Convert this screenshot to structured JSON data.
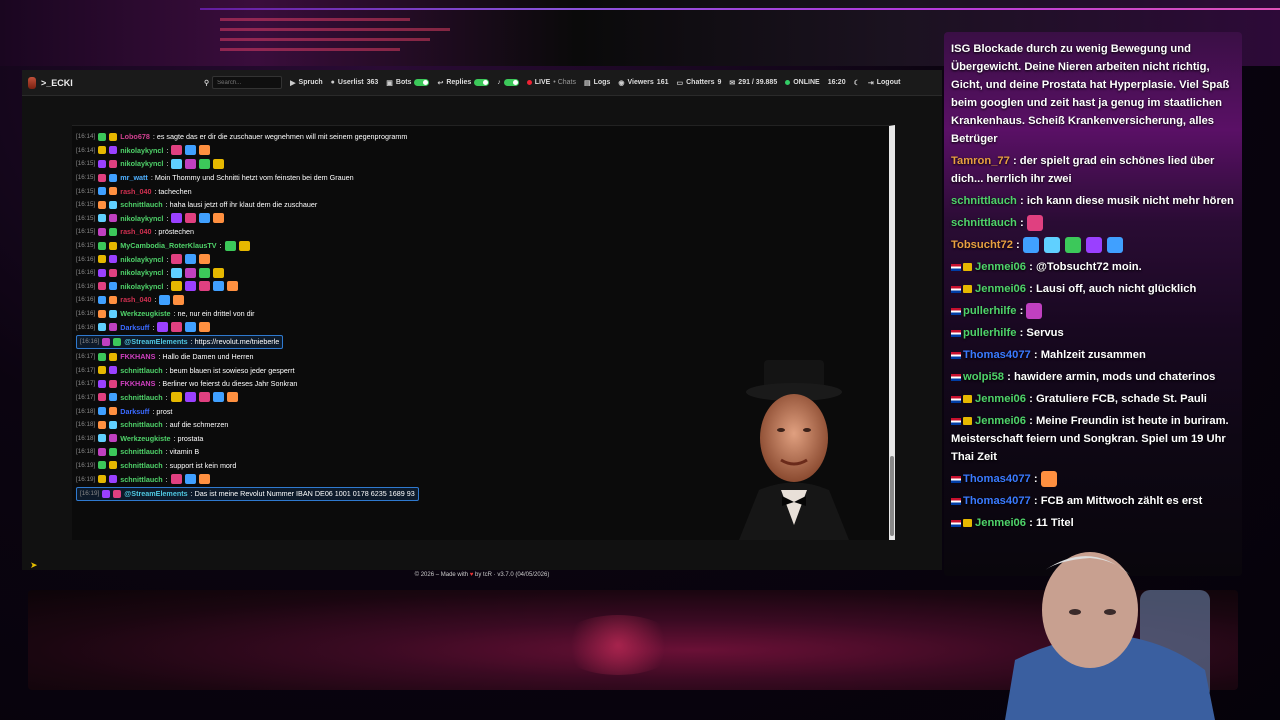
{
  "app": {
    "brand": ">_ECKI",
    "search_placeholder": "Search...",
    "nav": {
      "spruch": "Spruch",
      "userlist_label": "Userlist",
      "userlist_count": "363",
      "bots": "Bots",
      "replies": "Replies",
      "live": "LIVE",
      "chats": "• Chats",
      "logs": "Logs",
      "viewers_label": "Viewers",
      "viewers_count": "161",
      "chatters_label": "Chatters",
      "chatters_count": "9",
      "messages": "291 / 39.885",
      "online": "ONLINE",
      "time": "16:20",
      "logout": "Logout"
    },
    "footer": {
      "prefix": "© 2026 – Made with",
      "suffix": "by tcR · v3.7.0 (04/05/2026)"
    }
  },
  "chat_lines": [
    {
      "ts": "[16:14]",
      "nick": "Lobo678",
      "color": "#d04090",
      "text": ": es sagte das er dir die zuschauer wegnehmen will mit seinem gegenprogramm",
      "hl": false
    },
    {
      "ts": "[16:14]",
      "nick": "nikolaykyncl",
      "color": "#4fd36a",
      "text": ":",
      "hl": false
    },
    {
      "ts": "[16:15]",
      "nick": "nikolaykyncl",
      "color": "#4fd36a",
      "text": ":",
      "hl": false
    },
    {
      "ts": "[16:15]",
      "nick": "mr_watt",
      "color": "#4fb0ff",
      "text": ": Moin Thommy und Schnitti hetzt vom feinsten bei dem Grauen",
      "hl": false
    },
    {
      "ts": "[16:15]",
      "nick": "rash_040",
      "color": "#d03050",
      "text": ": tachechen",
      "hl": false
    },
    {
      "ts": "[16:15]",
      "nick": "schnittlauch",
      "color": "#4fd36a",
      "text": ": haha lausi jetzt off ihr klaut dem die zuschauer",
      "hl": false
    },
    {
      "ts": "[16:15]",
      "nick": "nikolaykyncl",
      "color": "#4fd36a",
      "text": ":",
      "hl": false
    },
    {
      "ts": "[16:15]",
      "nick": "rash_040",
      "color": "#d03050",
      "text": ": pröstechen",
      "hl": false
    },
    {
      "ts": "[16:15]",
      "nick": "MyCambodia_RoterKlausTV",
      "color": "#4fd36a",
      "text": ":",
      "hl": false
    },
    {
      "ts": "[16:16]",
      "nick": "nikolaykyncl",
      "color": "#4fd36a",
      "text": ":",
      "hl": false
    },
    {
      "ts": "[16:16]",
      "nick": "nikolaykyncl",
      "color": "#4fd36a",
      "text": ":",
      "hl": false
    },
    {
      "ts": "[16:16]",
      "nick": "nikolaykyncl",
      "color": "#4fd36a",
      "text": ":",
      "hl": false
    },
    {
      "ts": "[16:16]",
      "nick": "rash_040",
      "color": "#d03050",
      "text": ":",
      "hl": false
    },
    {
      "ts": "[16:16]",
      "nick": "Werkzeugkiste",
      "color": "#4fd36a",
      "text": ": ne, nur ein drittel von dir",
      "hl": false
    },
    {
      "ts": "[16:16]",
      "nick": "Darksuff",
      "color": "#3a6aff",
      "text": ":",
      "hl": false
    },
    {
      "ts": "[16:16]",
      "nick": "@StreamElements",
      "color": "#4fc6e0",
      "text": ": https://revolut.me/tnieberle",
      "hl": true
    },
    {
      "ts": "[16:17]",
      "nick": "FKKHANS",
      "color": "#d040c0",
      "text": ": Hallo die Damen und Herren",
      "hl": false
    },
    {
      "ts": "[16:17]",
      "nick": "schnittlauch",
      "color": "#4fd36a",
      "text": ": beum blauen ist sowieso jeder gesperrt",
      "hl": false
    },
    {
      "ts": "[16:17]",
      "nick": "FKKHANS",
      "color": "#d040c0",
      "text": ": Berliner wo feierst du dieses Jahr Sonkran",
      "hl": false
    },
    {
      "ts": "[16:17]",
      "nick": "schnittlauch",
      "color": "#4fd36a",
      "text": ":",
      "hl": false
    },
    {
      "ts": "[16:18]",
      "nick": "Darksuff",
      "color": "#3a6aff",
      "text": ": prost",
      "hl": false
    },
    {
      "ts": "[16:18]",
      "nick": "schnittlauch",
      "color": "#4fd36a",
      "text": ": auf die schmerzen",
      "hl": false
    },
    {
      "ts": "[16:18]",
      "nick": "Werkzeugkiste",
      "color": "#4fd36a",
      "text": ": prostata",
      "hl": false
    },
    {
      "ts": "[16:18]",
      "nick": "schnittlauch",
      "color": "#4fd36a",
      "text": ": vitamin B",
      "hl": false
    },
    {
      "ts": "[16:19]",
      "nick": "schnittlauch",
      "color": "#4fd36a",
      "text": ": support ist kein mord",
      "hl": false
    },
    {
      "ts": "[16:19]",
      "nick": "schnittlauch",
      "color": "#4fd36a",
      "text": ":",
      "hl": false
    },
    {
      "ts": "[16:19]",
      "nick": "@StreamElements",
      "color": "#4fc6e0",
      "text": ": Das ist meine Revolut Nummer IBAN DE06 1001 0178 6235 1689 93",
      "hl": true
    }
  ],
  "overlay_lines": [
    {
      "nick": "",
      "color": "#ffffff",
      "text": "ISG Blockade durch zu wenig Bewegung und Übergewicht. Deine Nieren arbeiten nicht richtig, Gicht, und deine Prostata hat Hyperplasie. Viel Spaß beim googlen und zeit hast ja genug im staatlichen Krankenhaus. Scheiß Krankenversicherung, alles Betrüger",
      "flag": false,
      "crown": false
    },
    {
      "nick": "Tamron_77",
      "color": "#e8a040",
      "text": " : der spielt grad ein schönes lied über dich... herrlich ihr zwei",
      "flag": false,
      "crown": false
    },
    {
      "nick": "schnittlauch",
      "color": "#4fd36a",
      "text": " : ich kann diese musik nicht mehr hören",
      "flag": false,
      "crown": false
    },
    {
      "nick": "schnittlauch",
      "color": "#4fd36a",
      "text": " :",
      "flag": false,
      "crown": false
    },
    {
      "nick": "Tobsucht72",
      "color": "#e8a040",
      "text": " :",
      "flag": false,
      "crown": false
    },
    {
      "nick": "Jenmei06",
      "color": "#4fd36a",
      "text": " : @Tobsucht72 moin.",
      "flag": true,
      "crown": true
    },
    {
      "nick": "Jenmei06",
      "color": "#4fd36a",
      "text": " : Lausi off, auch nicht glücklich",
      "flag": true,
      "crown": true
    },
    {
      "nick": "pullerhilfe",
      "color": "#4fd36a",
      "text": " :",
      "flag": true,
      "crown": false
    },
    {
      "nick": "pullerhilfe",
      "color": "#4fd36a",
      "text": " : Servus",
      "flag": true,
      "crown": false
    },
    {
      "nick": "Thomas4077",
      "color": "#3a7aff",
      "text": " : Mahlzeit zusammen",
      "flag": true,
      "crown": false
    },
    {
      "nick": "wolpi58",
      "color": "#4fd36a",
      "text": " : hawidere armin, mods und chaterinos",
      "flag": true,
      "crown": false
    },
    {
      "nick": "Jenmei06",
      "color": "#4fd36a",
      "text": " : Gratuliere FCB, schade St. Pauli",
      "flag": true,
      "crown": true
    },
    {
      "nick": "Jenmei06",
      "color": "#4fd36a",
      "text": " : Meine Freundin ist heute in buriram. Meisterschaft feiern und Songkran. Spiel um 19 Uhr Thai Zeit",
      "flag": true,
      "crown": true
    },
    {
      "nick": "Thomas4077",
      "color": "#3a7aff",
      "text": " :",
      "flag": true,
      "crown": false
    },
    {
      "nick": "Thomas4077",
      "color": "#3a7aff",
      "text": " : FCB am Mittwoch zählt es erst",
      "flag": true,
      "crown": false
    },
    {
      "nick": "Jenmei06",
      "color": "#4fd36a",
      "text": " : 11 Titel",
      "flag": true,
      "crown": true
    }
  ]
}
